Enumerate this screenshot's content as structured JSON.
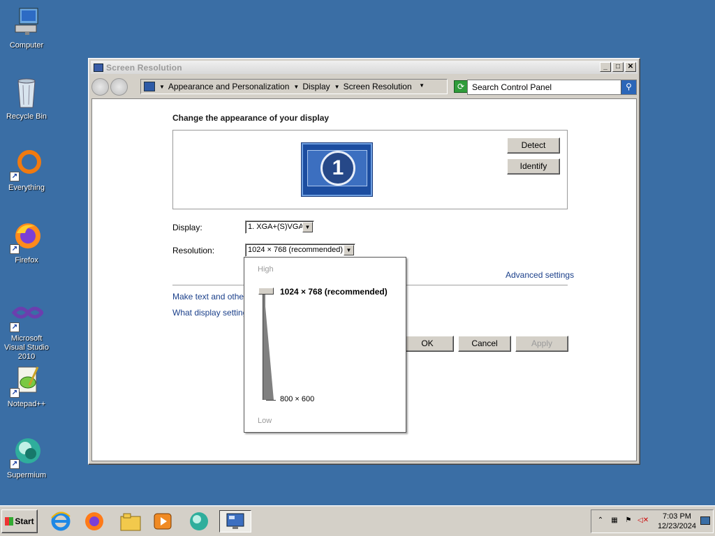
{
  "desktop": {
    "icons": [
      {
        "label": "Computer",
        "icon": "computer-icon"
      },
      {
        "label": "Recycle Bin",
        "icon": "recycle-bin-icon"
      },
      {
        "label": "Everything",
        "icon": "everything-icon"
      },
      {
        "label": "Firefox",
        "icon": "firefox-icon"
      },
      {
        "label": "Microsoft Visual Studio 2010",
        "icon": "visual-studio-icon"
      },
      {
        "label": "Notepad++",
        "icon": "notepadpp-icon"
      },
      {
        "label": "Supermium",
        "icon": "supermium-icon"
      }
    ]
  },
  "window": {
    "title": "Screen Resolution",
    "controls": {
      "minimize": "_",
      "maximize": "□",
      "close": "✕"
    },
    "breadcrumbs": [
      "Appearance and Personalization",
      "Display",
      "Screen Resolution"
    ],
    "search_placeholder": "Search Control Panel"
  },
  "main": {
    "heading": "Change the appearance of your display",
    "monitor_number": "1",
    "detect_label": "Detect",
    "identify_label": "Identify",
    "display_label": "Display:",
    "display_value": "1. XGA+(S)VGA",
    "resolution_label": "Resolution:",
    "resolution_value": "1024 × 768 (recommended)",
    "advanced_link": "Advanced settings",
    "text_size_link": "Make text and other i",
    "what_settings_link": "What display settings",
    "ok_label": "OK",
    "cancel_label": "Cancel",
    "apply_label": "Apply"
  },
  "resolution_popup": {
    "high_label": "High",
    "low_label": "Low",
    "top_option": "1024 × 768 (recommended)",
    "bottom_option": "800 × 600",
    "slider_level": 1.0
  },
  "taskbar": {
    "start_label": "Start",
    "pinned": [
      "internet-explorer-icon",
      "firefox-icon",
      "explorer-icon",
      "media-player-icon",
      "supermium-icon",
      "display-settings-icon"
    ],
    "time": "7:03 PM",
    "date": "12/23/2024",
    "tray_icons": [
      "show-hidden-icons-icon",
      "network-icon",
      "action-center-flag-icon",
      "volume-muted-icon"
    ]
  },
  "colors": {
    "desktop": "#3a6ea5",
    "link": "#1a3f8a"
  }
}
